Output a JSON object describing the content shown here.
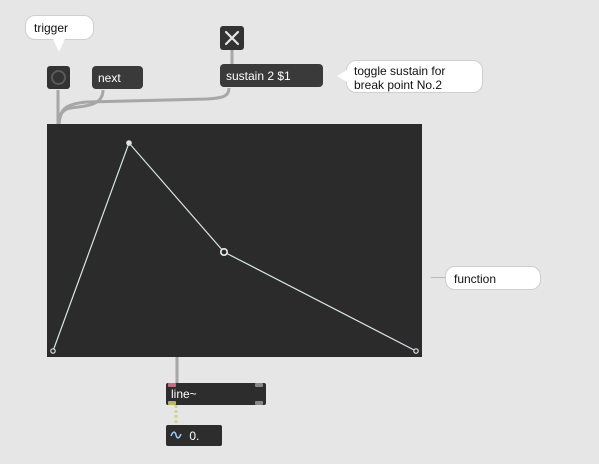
{
  "comments": {
    "trigger": "trigger",
    "sustain_note": "toggle sustain for break point No.2",
    "function": "function"
  },
  "messages": {
    "next": "next",
    "sustain": "sustain 2 $1"
  },
  "objects": {
    "line": "line~"
  },
  "number_box": {
    "value": "0."
  },
  "icons": {
    "button": "bang-button-icon",
    "toggle": "toggle-x-icon",
    "signal": "signal-wave-icon"
  },
  "colors": {
    "canvas": "#e6e6e6",
    "object": "#333333",
    "function_bg": "#2b2b2b",
    "function_line": "#d9e6e6",
    "wire": "#a7a7a7",
    "signal_wire": "#c8c86a"
  }
}
